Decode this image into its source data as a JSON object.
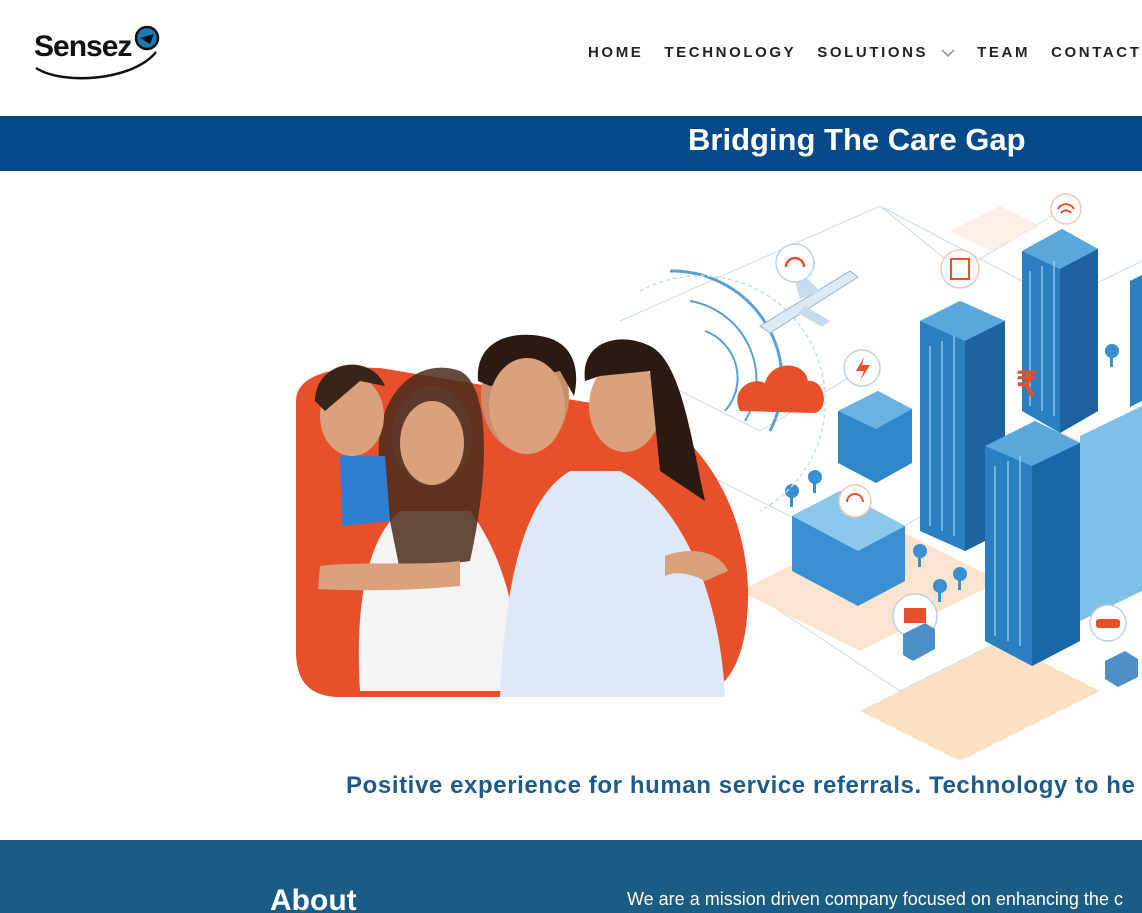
{
  "logo": {
    "text": "Sensez"
  },
  "nav": {
    "home": "HOME",
    "technology": "TECHNOLOGY",
    "solutions": "SOLUTIONS",
    "team": "TEAM",
    "contact": "CONTACT"
  },
  "banner": {
    "title": "Bridging The Care Gap"
  },
  "hero": {
    "tagline": "Positive experience for human service referrals. Technology to he",
    "image": "family-smart-city-illustration",
    "city_icons": [
      "headset-icon",
      "airplane-icon",
      "cloud-icon",
      "elevator-icon",
      "wifi-icon",
      "lightning-icon",
      "rupee-icon",
      "mail-icon",
      "car-icon",
      "truck-icon"
    ]
  },
  "about": {
    "title": "About",
    "text": "We are a mission driven company focused on enhancing the c"
  },
  "colors": {
    "banner": "#044a8a",
    "tagline": "#1f5a8a",
    "about_bg": "#1a5c84",
    "accent_orange": "#e8502c",
    "city_blue": "#2a7fc0"
  }
}
